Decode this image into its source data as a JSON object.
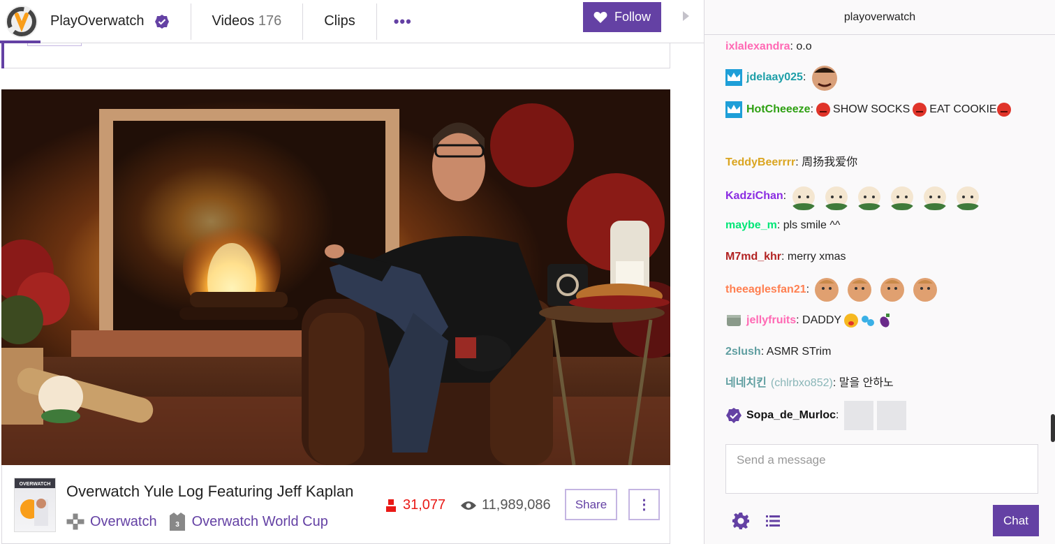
{
  "header": {
    "channel_name": "PlayOverwatch",
    "nav": [
      {
        "label": "Videos",
        "count": "176"
      },
      {
        "label": "Clips",
        "count": ""
      }
    ],
    "more_label": "•••",
    "follow_label": "Follow"
  },
  "vod": {
    "title": "Overwatch Yule Log Featuring Jeff Kaplan",
    "game": "Overwatch",
    "collection": "Overwatch World Cup",
    "viewers": "31,077",
    "views": "11,989,086",
    "share_label": "Share",
    "more_label": "⋮",
    "boxart_text": "OVERWATCH"
  },
  "chat": {
    "header": "playoverwatch",
    "messages": [
      {
        "user": "ixlalexandra",
        "color": "#ff69b4",
        "text": ": o.o"
      },
      {
        "user": "jdelaay025",
        "color": "#1e9fa8",
        "text": ":"
      },
      {
        "user": "HotCheeeze",
        "color": "#2ea012",
        "text": ":",
        "parts": [
          "SHOW SOCKS",
          "EAT COOKIE"
        ]
      },
      {
        "user": "TeddyBeerrrr",
        "color": "#daa520",
        "text": ": 周扬我爱你"
      },
      {
        "user": "KadziChan",
        "color": "#8a2be2",
        "text": ":"
      },
      {
        "user": "maybe_m",
        "color": "#00ff7f",
        "text": ": pls smile ^^"
      },
      {
        "user": "M7md_khr",
        "color": "#b22222",
        "text": ": merry xmas"
      },
      {
        "user": "theeaglesfan21",
        "color": "#ff7f50",
        "text": ":"
      },
      {
        "user": "jellyfruits",
        "color": "#ff69b4",
        "text": ": DADDY"
      },
      {
        "user": "2slush",
        "color": "#5f9ea0",
        "text": ": ASMR STrim"
      },
      {
        "user": "네네치킨",
        "alt": "(chlrbxo852)",
        "color": "#5f9ea0",
        "text": ": 말을 안하노"
      },
      {
        "user": "Sopa_de_Murloc",
        "color": "#111111",
        "text": ":"
      }
    ],
    "input_placeholder": "Send a message",
    "send_label": "Chat"
  },
  "colors": {
    "brand": "#6441a4",
    "live_red": "#e91916"
  }
}
